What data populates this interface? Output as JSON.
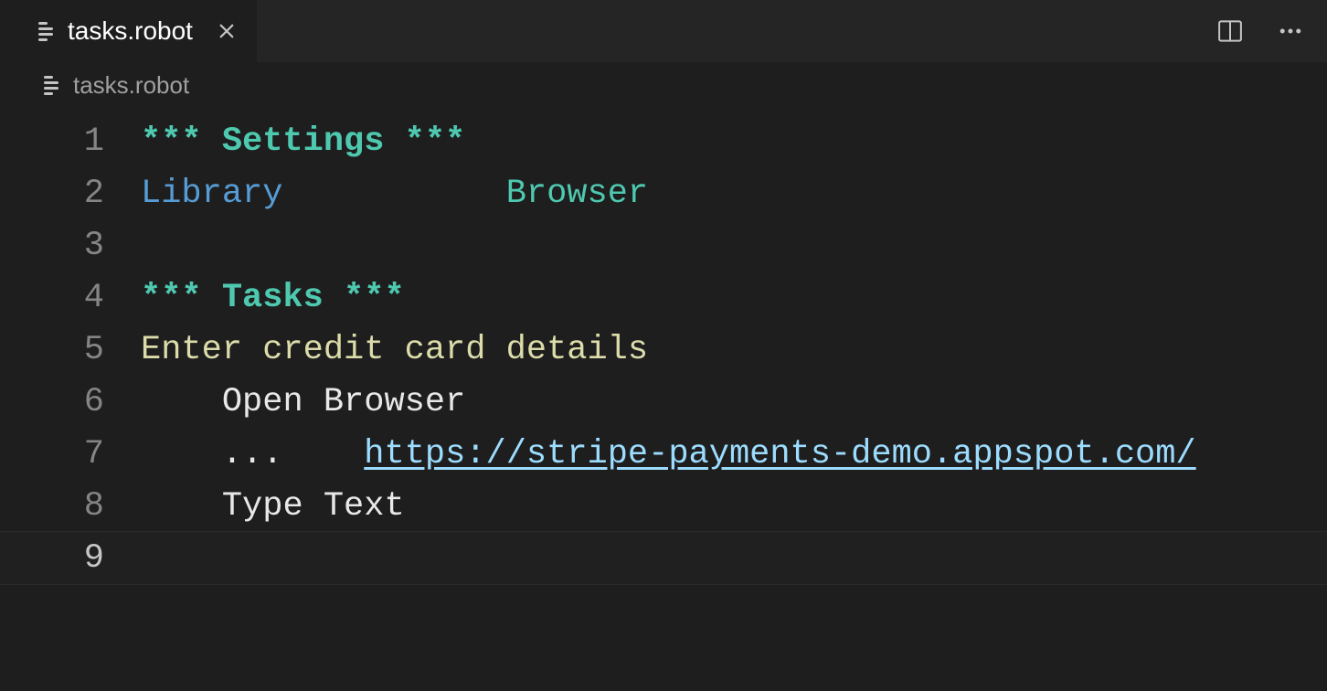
{
  "tab": {
    "label": "tasks.robot"
  },
  "breadcrumb": {
    "label": "tasks.robot"
  },
  "linenos": [
    "1",
    "2",
    "3",
    "4",
    "5",
    "6",
    "7",
    "8",
    "9"
  ],
  "code": {
    "l1": "*** Settings ***",
    "l2_kw": "Library",
    "l2_arg": "Browser",
    "l4": "*** Tasks ***",
    "l5": "Enter credit card details",
    "l6": "Open Browser",
    "l7_dots": "...",
    "l7_url": "https://stripe-payments-demo.appspot.com/",
    "l8": "Type Text"
  },
  "spacing": {
    "l2_gap": "           ",
    "indent4": "    ",
    "l7_gap": "    "
  }
}
